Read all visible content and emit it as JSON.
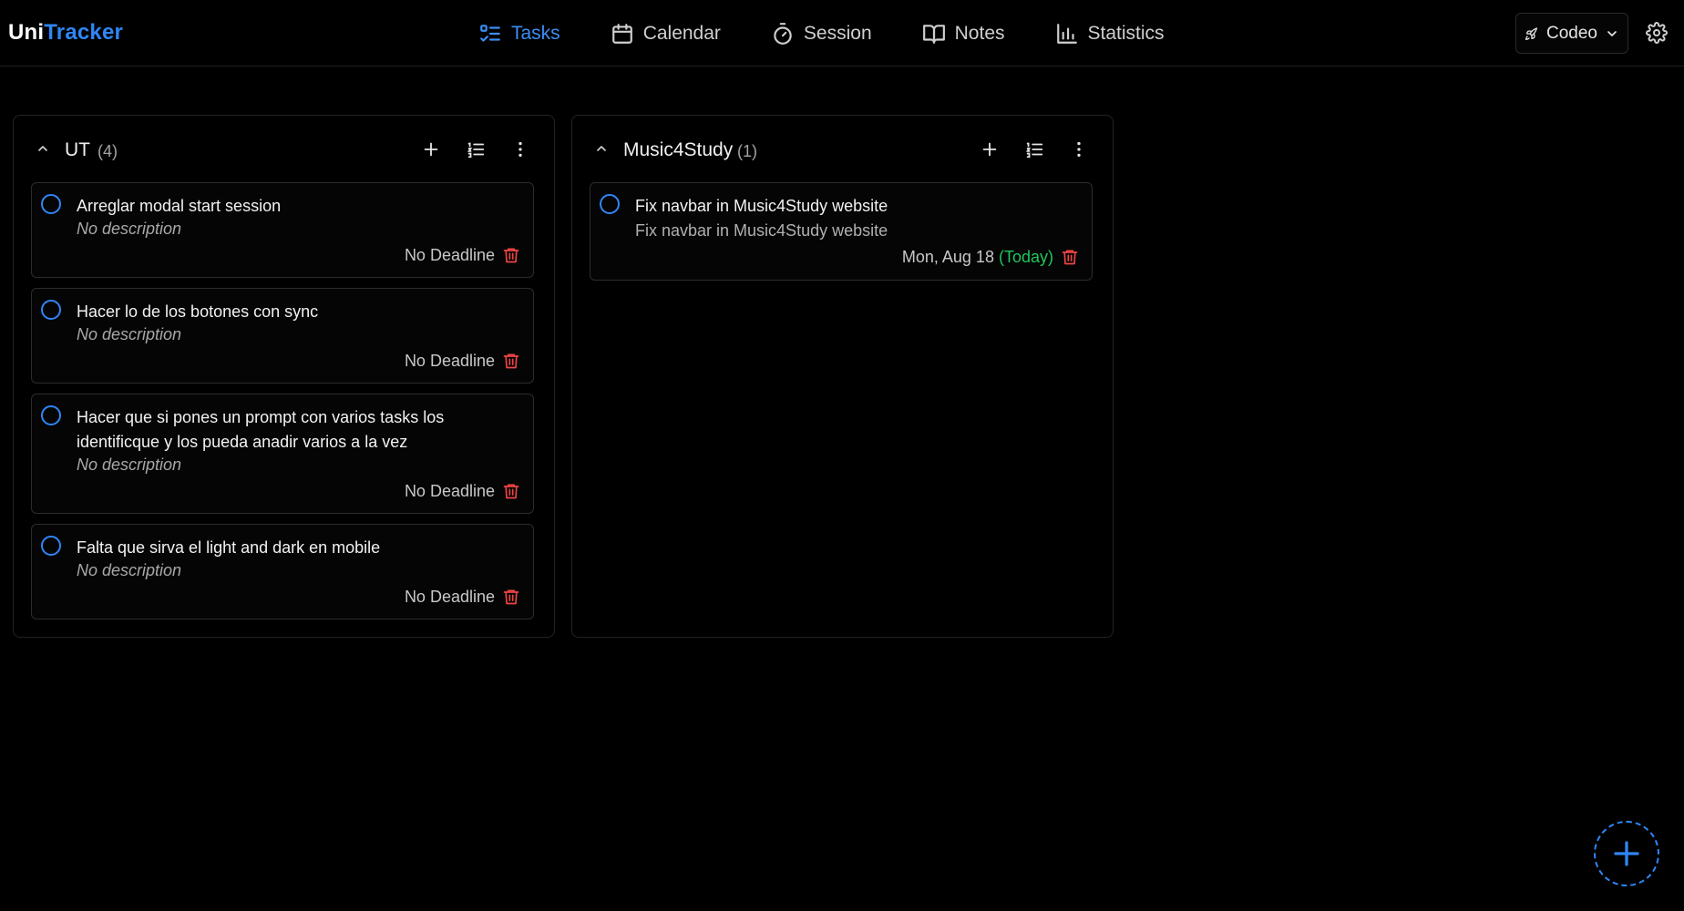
{
  "app": {
    "logo_part1": "Uni",
    "logo_part2": "Tracker"
  },
  "nav": [
    {
      "label": "Tasks",
      "icon": "list-check-icon",
      "active": true
    },
    {
      "label": "Calendar",
      "icon": "calendar-icon"
    },
    {
      "label": "Session",
      "icon": "timer-icon"
    },
    {
      "label": "Notes",
      "icon": "book-icon"
    },
    {
      "label": "Statistics",
      "icon": "bar-chart-icon"
    }
  ],
  "workspace": {
    "label": "Codeo",
    "icon": "rocket-icon"
  },
  "columns": [
    {
      "title": "UT",
      "count": "(4)",
      "tasks": [
        {
          "title": "Arreglar modal start session",
          "description": "No description",
          "deadline": "No Deadline"
        },
        {
          "title": "Hacer lo de los botones con sync",
          "description": "No description",
          "deadline": "No Deadline"
        },
        {
          "title": "Hacer que si pones un prompt con varios tasks los identificque y los pueda anadir varios a la vez",
          "description": "No description",
          "deadline": "No Deadline"
        },
        {
          "title": "Falta que sirva el light and dark en mobile",
          "description": "No description",
          "deadline": "No Deadline"
        }
      ]
    },
    {
      "title": "Music4Study",
      "count": "(1)",
      "tasks": [
        {
          "title": "Fix navbar in Music4Study website",
          "description": "Fix navbar in Music4Study website",
          "deadline": "Mon, Aug 18",
          "deadline_note": "(Today)"
        }
      ]
    }
  ],
  "colors": {
    "accent": "#2f86f6",
    "danger": "#ef4444",
    "today": "#22c55e",
    "background": "#000000"
  }
}
